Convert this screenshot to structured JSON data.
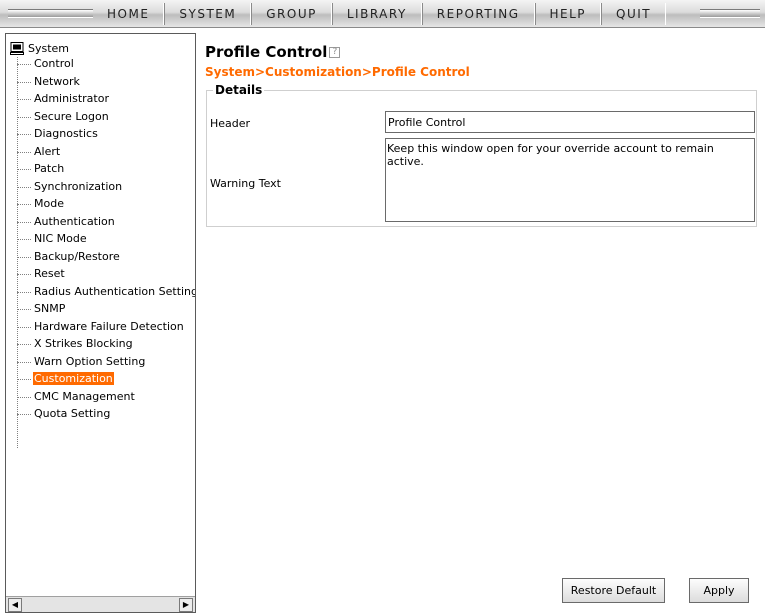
{
  "nav": {
    "items": [
      "HOME",
      "SYSTEM",
      "GROUP",
      "LIBRARY",
      "REPORTING",
      "HELP",
      "QUIT"
    ]
  },
  "tree": {
    "root_label": "System",
    "root_icon": "computer-icon",
    "items": [
      "Control",
      "Network",
      "Administrator",
      "Secure Logon",
      "Diagnostics",
      "Alert",
      "Patch",
      "Synchronization",
      "Mode",
      "Authentication",
      "NIC Mode",
      "Backup/Restore",
      "Reset",
      "Radius Authentication Setting",
      "SNMP",
      "Hardware Failure Detection",
      "X Strikes Blocking",
      "Warn Option Setting",
      "Customization",
      "CMC Management",
      "Quota Setting"
    ],
    "selected_index": 18,
    "scroll_left_icon": "arrow-left-icon",
    "scroll_right_icon": "arrow-right-icon"
  },
  "page": {
    "title": "Profile Control",
    "help_icon": "help-icon",
    "breadcrumb": "System>Customization>Profile Control",
    "details_legend": "Details",
    "header_label": "Header",
    "header_value": "Profile Control",
    "warning_label": "Warning Text",
    "warning_value": "Keep this window open for your override account to remain active.",
    "restore_label": "Restore Default",
    "apply_label": "Apply"
  },
  "colors": {
    "accent": "#ff6a00",
    "selection": "#ff6a00"
  }
}
